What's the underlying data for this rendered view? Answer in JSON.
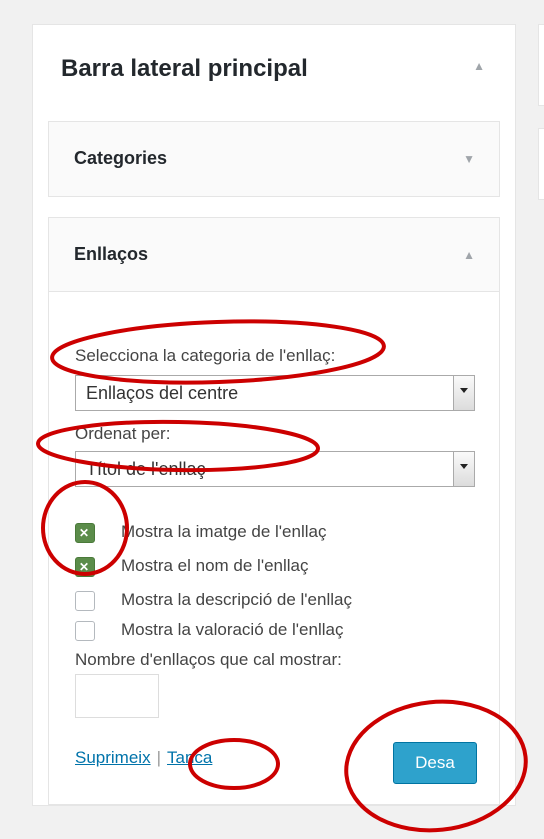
{
  "sidebar": {
    "title": "Barra lateral principal"
  },
  "widgets": {
    "categories": {
      "title": "Categories"
    },
    "links": {
      "title": "Enllaços",
      "category_label": "Selecciona la categoria de l'enllaç:",
      "category_value": "Enllaços del centre",
      "order_label": "Ordenat per:",
      "order_value": "Títol de l'enllaç",
      "options": [
        {
          "label": "Mostra la imatge de l'enllaç",
          "checked": true
        },
        {
          "label": "Mostra el nom de l'enllaç",
          "checked": true
        },
        {
          "label": "Mostra la descripció de l'enllaç",
          "checked": false
        },
        {
          "label": "Mostra la valoració de l'enllaç",
          "checked": false
        }
      ],
      "count_label": "Nombre d'enllaços que cal mostrar:",
      "count_value": "",
      "delete_label": "Suprimeix",
      "separator": "|",
      "close_label": "Tanca",
      "save_label": "Desa"
    }
  },
  "colors": {
    "save_button": "#2ea2cc",
    "link": "#0073aa",
    "checkbox_checked": "#5b8c4a",
    "annotation": "#cc0000"
  },
  "icons": {
    "collapse": "up-arrow-icon",
    "expand": "down-arrow-icon"
  }
}
